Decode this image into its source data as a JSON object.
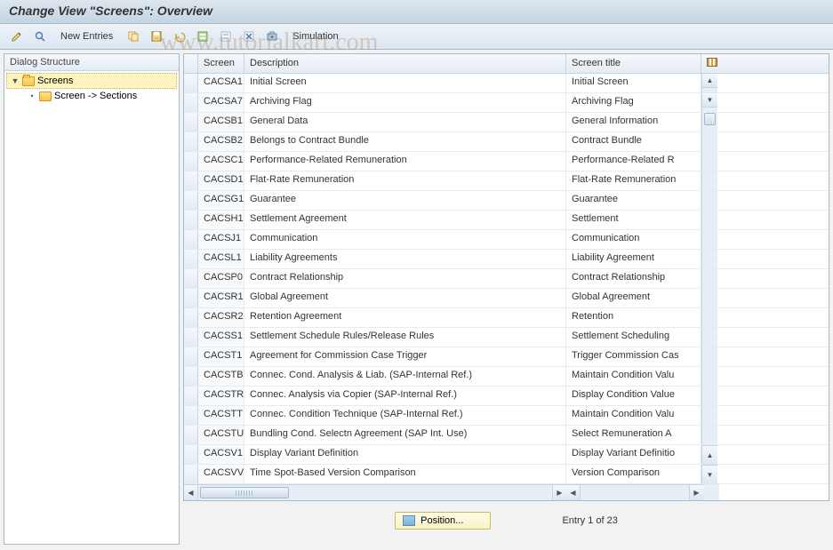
{
  "header": {
    "title": "Change View \"Screens\": Overview"
  },
  "toolbar": {
    "new_entries": "New Entries",
    "simulation": "Simulation"
  },
  "sidebar": {
    "header": "Dialog Structure",
    "items": [
      {
        "label": "Screens",
        "selected": true
      },
      {
        "label": "Screen -> Sections",
        "selected": false
      }
    ]
  },
  "table": {
    "columns": {
      "screen": "Screen",
      "description": "Description",
      "title": "Screen title"
    },
    "rows": [
      {
        "screen": "CACSA1",
        "desc": "Initial Screen",
        "title": "Initial Screen"
      },
      {
        "screen": "CACSA7",
        "desc": "Archiving Flag",
        "title": "Archiving Flag"
      },
      {
        "screen": "CACSB1",
        "desc": "General Data",
        "title": "General Information"
      },
      {
        "screen": "CACSB2",
        "desc": "Belongs to Contract Bundle",
        "title": "Contract Bundle"
      },
      {
        "screen": "CACSC1",
        "desc": "Performance-Related Remuneration",
        "title": "Performance-Related R"
      },
      {
        "screen": "CACSD1",
        "desc": "Flat-Rate Remuneration",
        "title": "Flat-Rate Remuneration"
      },
      {
        "screen": "CACSG1",
        "desc": "Guarantee",
        "title": "Guarantee"
      },
      {
        "screen": "CACSH1",
        "desc": "Settlement Agreement",
        "title": "Settlement"
      },
      {
        "screen": "CACSJ1",
        "desc": "Communication",
        "title": "Communication"
      },
      {
        "screen": "CACSL1",
        "desc": "Liability Agreements",
        "title": "Liability Agreement"
      },
      {
        "screen": "CACSP0",
        "desc": "Contract Relationship",
        "title": "Contract Relationship"
      },
      {
        "screen": "CACSR1",
        "desc": "Global Agreement",
        "title": "Global Agreement"
      },
      {
        "screen": "CACSR2",
        "desc": "Retention Agreement",
        "title": "Retention"
      },
      {
        "screen": "CACSS1",
        "desc": "Settlement Schedule Rules/Release Rules",
        "title": "Settlement Scheduling"
      },
      {
        "screen": "CACST1",
        "desc": "Agreement for Commission Case Trigger",
        "title": "Trigger Commission Cas"
      },
      {
        "screen": "CACSTB",
        "desc": "Connec. Cond. Analysis & Liab. (SAP-Internal Ref.)",
        "title": "Maintain Condition Valu"
      },
      {
        "screen": "CACSTR",
        "desc": "Connec. Analysis via Copier (SAP-Internal Ref.)",
        "title": "Display Condition Value"
      },
      {
        "screen": "CACSTT",
        "desc": "Connec. Condition Technique (SAP-Internal Ref.)",
        "title": "Maintain Condition Valu"
      },
      {
        "screen": "CACSTU",
        "desc": "Bundling Cond. Selectn Agreement (SAP Int. Use)",
        "title": "Select Remuneration A"
      },
      {
        "screen": "CACSV1",
        "desc": "Display Variant Definition",
        "title": "Display Variant Definitio"
      },
      {
        "screen": "CACSVV",
        "desc": "Time Spot-Based Version Comparison",
        "title": "Version Comparison"
      }
    ]
  },
  "footer": {
    "position_label": "Position...",
    "entry_text": "Entry 1 of 23"
  },
  "watermark": "www.tutorialkart.com"
}
